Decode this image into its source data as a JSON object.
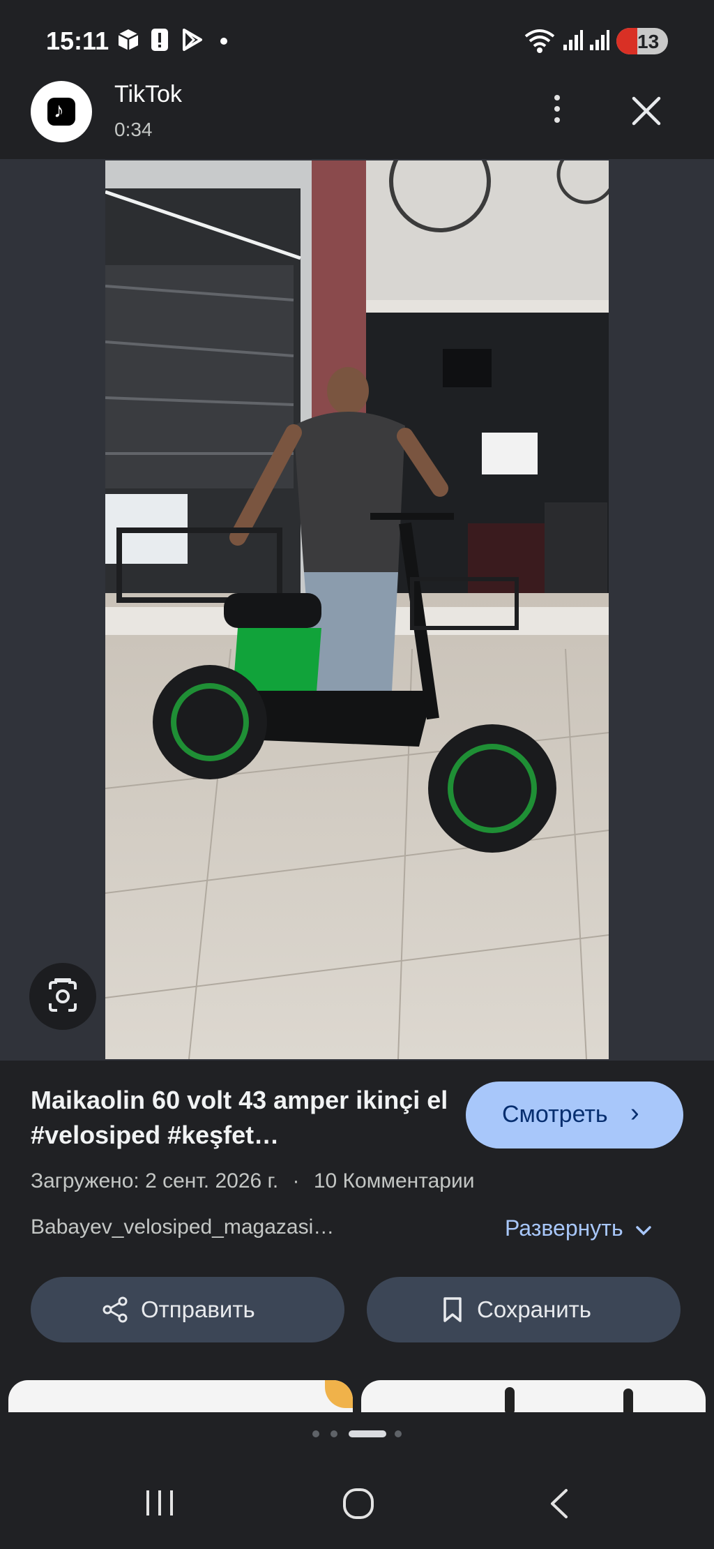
{
  "status_bar": {
    "time": "15:11",
    "battery": "13",
    "icons": [
      "package-icon",
      "alert-icon",
      "play-store-icon",
      "dot-icon",
      "wifi-icon",
      "signal-icon",
      "signal-icon",
      "battery-icon"
    ]
  },
  "app": {
    "name": "TikTok",
    "duration": "0:34"
  },
  "video": {
    "title": "Maikaolin 60 volt 43 amper ikinçi el #velosiped #keşfet…",
    "watch_label": "Смотреть",
    "uploaded": "Загружено: 2 сент. 2026 г.",
    "separator": "·",
    "comments": "10 Комментарии",
    "channel": "Babayev_velosiped_magazasi…",
    "expand_label": "Развернуть"
  },
  "actions": {
    "share_label": "Отправить",
    "save_label": "Сохранить"
  },
  "colors": {
    "background": "#202124",
    "accent": "#a8c7fa",
    "pill": "#3c4656"
  }
}
